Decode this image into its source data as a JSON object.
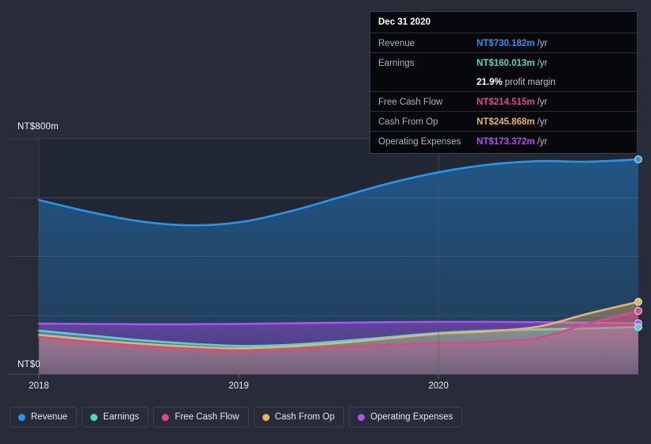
{
  "chart_data": {
    "type": "area",
    "title": "",
    "xlabel": "",
    "ylabel": "",
    "currency": "NT$",
    "unit_suffix": "m",
    "period": "/yr",
    "ylim": [
      0,
      800
    ],
    "y_ticks": [
      0,
      800
    ],
    "y_tick_labels": [
      "NT$0",
      "NT$800m"
    ],
    "grid": true,
    "legend_position": "bottom",
    "x_tick_labels": [
      "2018",
      "2019",
      "2020"
    ],
    "x": [
      "2018.00",
      "2018.25",
      "2018.50",
      "2018.75",
      "2019.00",
      "2019.25",
      "2019.50",
      "2019.75",
      "2020.00",
      "2020.25",
      "2020.50",
      "2020.75",
      "2021.00"
    ],
    "series": [
      {
        "name": "Revenue",
        "color": "#2196f3",
        "values": [
          592,
          552,
          520,
          506,
          516,
          552,
          600,
          648,
          686,
          712,
          724,
          722,
          730
        ]
      },
      {
        "name": "Earnings",
        "color": "#4ad9c4",
        "values": [
          148,
          132,
          116,
          104,
          96,
          100,
          112,
          126,
          140,
          148,
          152,
          156,
          160
        ]
      },
      {
        "name": "Free Cash Flow",
        "color": "#e0458b",
        "values": [
          126,
          110,
          96,
          86,
          80,
          84,
          92,
          100,
          106,
          110,
          124,
          172,
          215
        ]
      },
      {
        "name": "Cash From Op",
        "color": "#e8b463",
        "values": [
          134,
          118,
          104,
          94,
          88,
          94,
          106,
          122,
          138,
          146,
          162,
          206,
          246
        ]
      },
      {
        "name": "Operating Expenses",
        "color": "#b44ef0",
        "values": [
          172,
          171,
          170,
          170,
          171,
          173,
          175,
          177,
          178,
          178,
          177,
          175,
          173
        ]
      }
    ]
  },
  "tooltip": {
    "date": "Dec 31 2020",
    "unit": "/yr",
    "rows": [
      {
        "label": "Revenue",
        "value": "NT$730.182m",
        "unit": "/yr",
        "color": "#2196f3"
      },
      {
        "label": "Earnings",
        "value": "NT$160.013m",
        "unit": "/yr",
        "color": "#4ad9c4"
      },
      {
        "label": "",
        "value": "21.9%",
        "unit": "profit margin",
        "color": "#ffffff"
      },
      {
        "label": "Free Cash Flow",
        "value": "NT$214.515m",
        "unit": "/yr",
        "color": "#e0458b"
      },
      {
        "label": "Cash From Op",
        "value": "NT$245.868m",
        "unit": "/yr",
        "color": "#e8b463"
      },
      {
        "label": "Operating Expenses",
        "value": "NT$173.372m",
        "unit": "/yr",
        "color": "#b44ef0"
      }
    ]
  },
  "axis": {
    "y_top_label": "NT$800m",
    "y_bottom_label": "NT$0"
  },
  "legend": {
    "items": [
      {
        "label": "Revenue",
        "color": "#2196f3"
      },
      {
        "label": "Earnings",
        "color": "#4ad9c4"
      },
      {
        "label": "Free Cash Flow",
        "color": "#e0458b"
      },
      {
        "label": "Cash From Op",
        "color": "#e8b463"
      },
      {
        "label": "Operating Expenses",
        "color": "#b44ef0"
      }
    ]
  },
  "colors": {
    "background": "#272c38",
    "plot_background": "#222734",
    "gridline": "#3c4352",
    "tooltip_background": "#07080b",
    "tooltip_border": "#3a4050"
  }
}
